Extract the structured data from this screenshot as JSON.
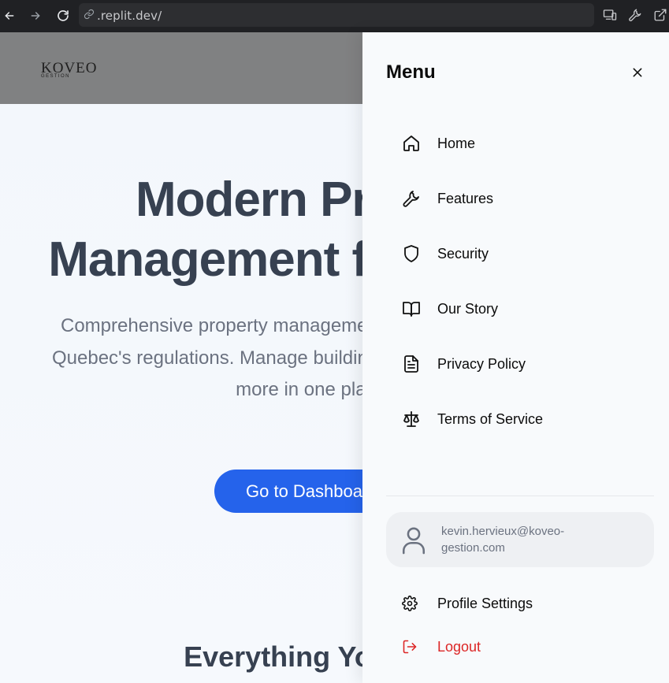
{
  "browser": {
    "url": ".replit.dev/"
  },
  "site": {
    "logo_main": "KOVEO",
    "logo_sub": "GESTION",
    "hero_title_line1": "Modern Property",
    "hero_title_line2": "Management for Quebec",
    "hero_subtitle": "Comprehensive property management designed specifically for Quebec's regulations. Manage buildings, residents, finances, and more in one platform.",
    "cta_label": "Go to Dashboard",
    "section_title": "Everything You Need"
  },
  "menu": {
    "title": "Menu",
    "items": [
      {
        "label": "Home",
        "icon": "home-icon"
      },
      {
        "label": "Features",
        "icon": "wrench-icon"
      },
      {
        "label": "Security",
        "icon": "shield-icon"
      },
      {
        "label": "Our Story",
        "icon": "book-open-icon"
      },
      {
        "label": "Privacy Policy",
        "icon": "file-text-icon"
      },
      {
        "label": "Terms of Service",
        "icon": "scale-icon"
      }
    ],
    "user_email": "kevin.hervieux@koveo-gestion.com",
    "profile_settings": "Profile Settings",
    "logout": "Logout"
  },
  "colors": {
    "accent": "#2563eb",
    "logout": "#dc2626",
    "heading": "#374151"
  }
}
